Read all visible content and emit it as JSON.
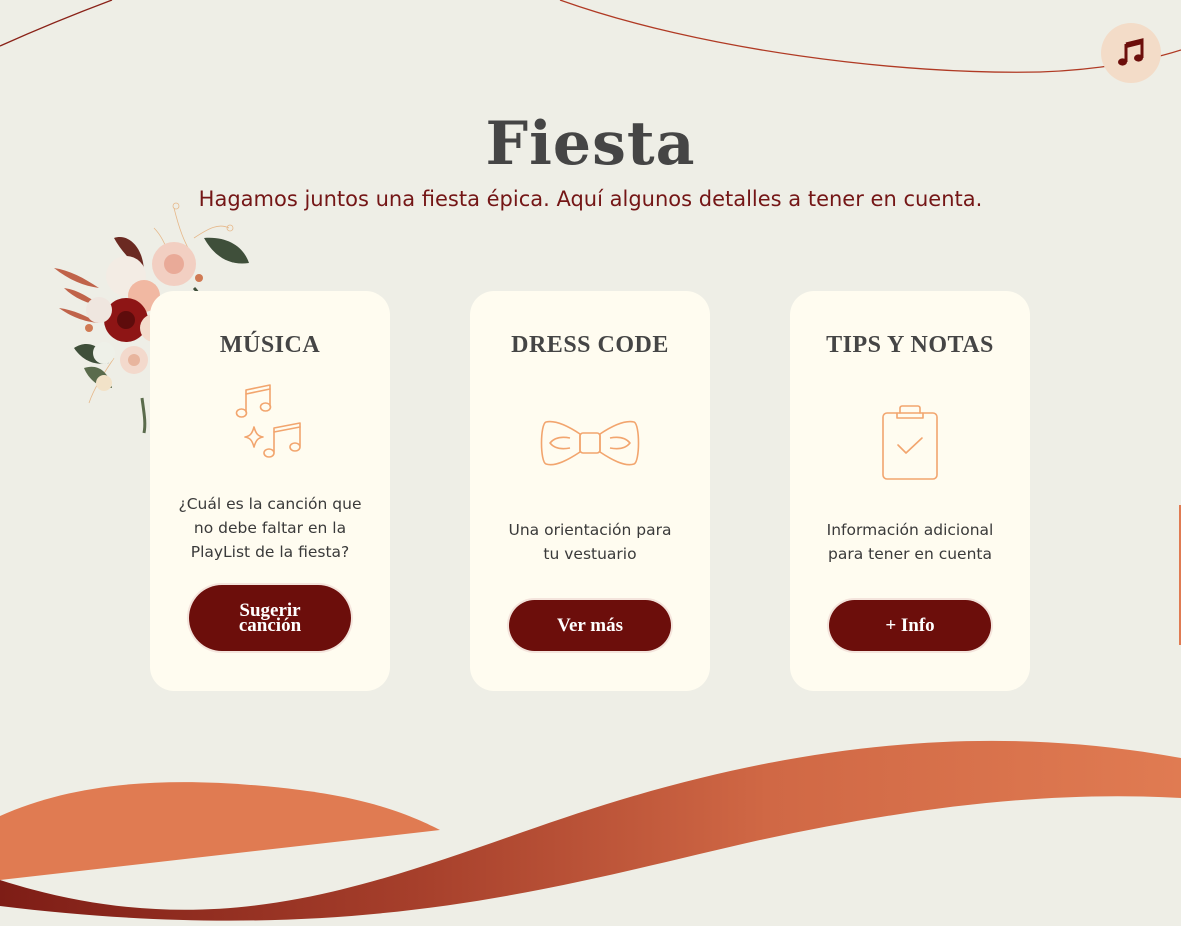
{
  "page": {
    "title": "Fiesta",
    "subtitle": "Hagamos juntos una fiesta épica. Aquí algunos detalles a tener en cuenta."
  },
  "music_toggle": {
    "icon": "music-note-icon"
  },
  "cards": [
    {
      "title": "MÚSICA",
      "icon": "music-notes-icon",
      "text_lines": [
        "¿Cuál es la canción que",
        "no debe faltar en la",
        "PlayList de la fiesta?"
      ],
      "button_lines": [
        "Sugerir",
        "canción"
      ]
    },
    {
      "title": "DRESS CODE",
      "icon": "bow-tie-icon",
      "text_lines": [
        "Una orientación para",
        "tu vestuario"
      ],
      "button_lines": [
        "Ver más"
      ]
    },
    {
      "title": "TIPS Y NOTAS",
      "icon": "clipboard-check-icon",
      "text_lines": [
        "Información adicional",
        "para tener en cuenta"
      ],
      "button_lines": [
        "+ Info"
      ]
    }
  ],
  "colors": {
    "background": "#eeeee6",
    "card": "#fffcf0",
    "accent": "#6c0e0b",
    "subtitle": "#741616",
    "icon_line": "#f2a56e",
    "wave_orange": "#e07b52",
    "wave_dark": "#8a2218"
  }
}
